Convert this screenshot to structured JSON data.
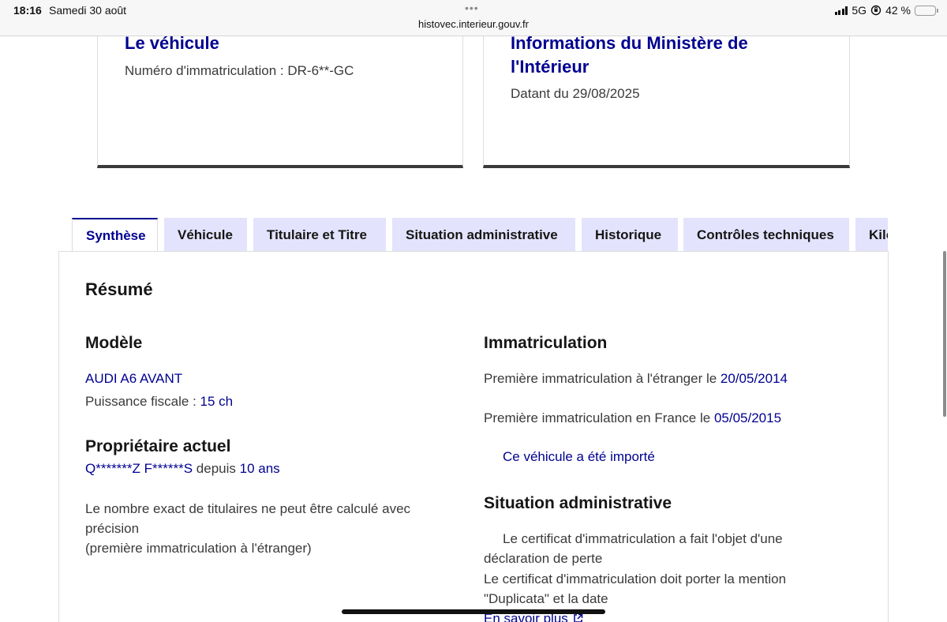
{
  "status_bar": {
    "time": "18:16",
    "date": "Samedi 30 août",
    "url": "histovec.interieur.gouv.fr",
    "network": "5G",
    "battery": "42 %",
    "battery_level": 0.42,
    "icons": [
      "signal-icon",
      "orientation-lock-icon",
      "battery-icon"
    ]
  },
  "cards": {
    "vehicle": {
      "title": "Le véhicule",
      "plate": "Numéro d'immatriculation : DR-6**-GC"
    },
    "ministry": {
      "title": "Informations du Ministère de l'Intérieur",
      "date": "Datant du 29/08/2025"
    }
  },
  "tabs": [
    {
      "label": "Synthèse",
      "active": true
    },
    {
      "label": "Véhicule",
      "active": false
    },
    {
      "label": "Titulaire et Titre",
      "active": false
    },
    {
      "label": "Situation administrative",
      "active": false
    },
    {
      "label": "Historique",
      "active": false
    },
    {
      "label": "Contrôles techniques",
      "active": false
    },
    {
      "label": "Kilométrage",
      "active": false
    }
  ],
  "summary": {
    "title": "Résumé",
    "model": {
      "heading": "Modèle",
      "name": "AUDI A6 AVANT",
      "fiscal_label": "Puissance fiscale : ",
      "fiscal_value": "15 ch"
    },
    "owner": {
      "heading": "Propriétaire actuel",
      "name": "Q*******Z F******S",
      "since_label": " depuis ",
      "since_value": "10 ans",
      "note_line1": "Le nombre exact de titulaires ne peut être calculé avec",
      "note_line2": "précision",
      "note_line3": "(première immatriculation à l'étranger)"
    },
    "registration": {
      "heading": "Immatriculation",
      "foreign_label": "Première immatriculation à l'étranger le ",
      "foreign_date": "20/05/2014",
      "france_label": "Première immatriculation en France le ",
      "france_date": "05/05/2015",
      "imported": "Ce véhicule a été importé"
    },
    "admin": {
      "heading": "Situation administrative",
      "line1": "Le certificat d'immatriculation a fait l'objet d'une",
      "line2": "déclaration de perte",
      "line3": "Le certificat d'immatriculation doit porter la mention",
      "line4": "\"Duplicata\" et la date",
      "more_link": "En savoir plus"
    }
  }
}
